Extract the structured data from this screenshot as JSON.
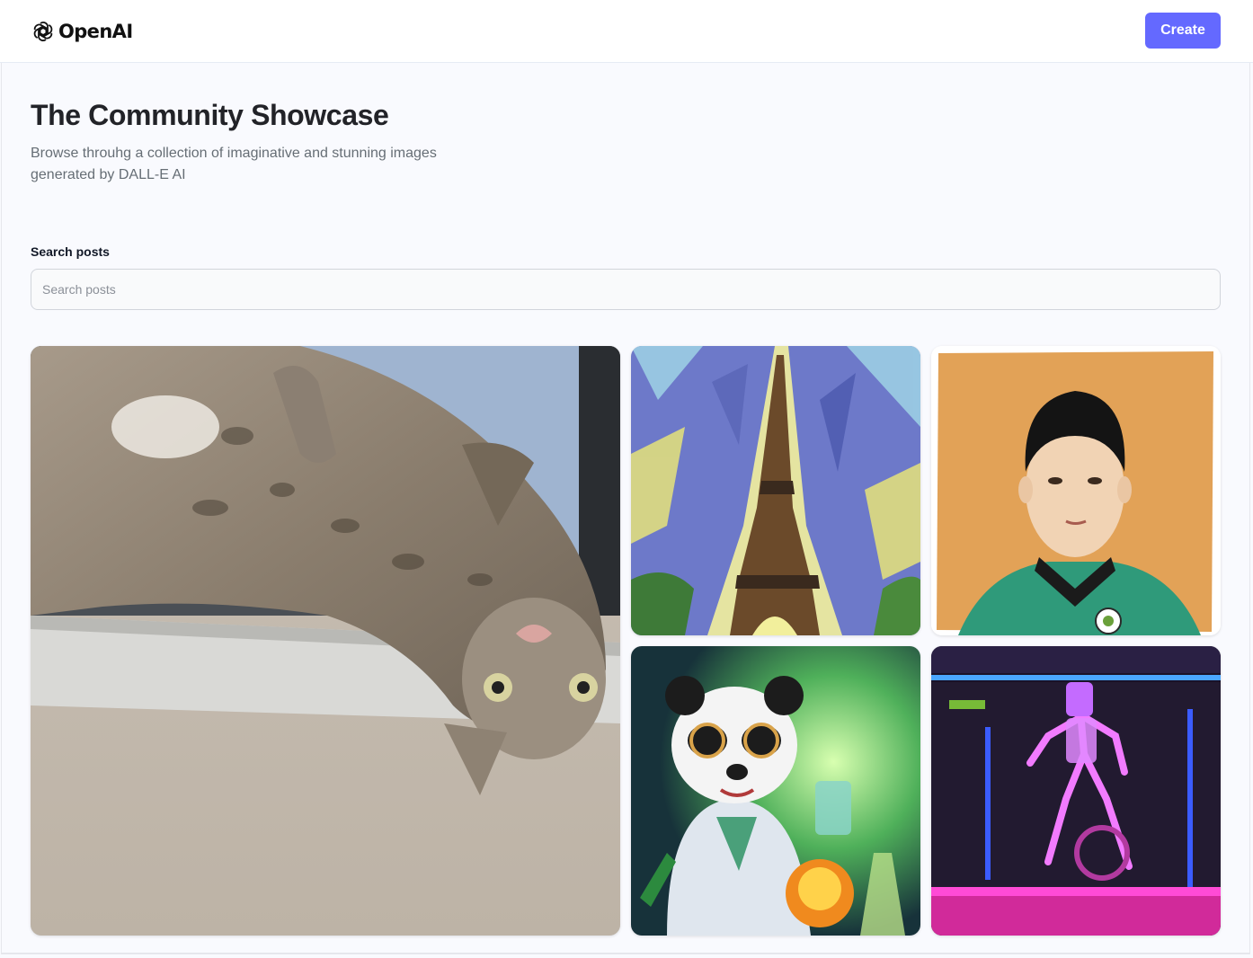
{
  "header": {
    "logo_text": "OpenAI",
    "create_label": "Create"
  },
  "hero": {
    "title": "The Community Showcase",
    "subtitle": "Browse throuhg a collection of imaginative and stunning images generated by DALL-E AI"
  },
  "search": {
    "label": "Search posts",
    "placeholder": "Search posts",
    "value": ""
  },
  "gallery": {
    "cards": [
      {
        "subject": "cat"
      },
      {
        "subject": "eiffel-tower"
      },
      {
        "subject": "boy-portrait"
      },
      {
        "subject": "panda-scientist"
      },
      {
        "subject": "neon-robot"
      }
    ]
  },
  "colors": {
    "accent": "#6469ff",
    "page_bg": "#f9fafe",
    "title": "#222328",
    "subtitle": "#666e75"
  }
}
